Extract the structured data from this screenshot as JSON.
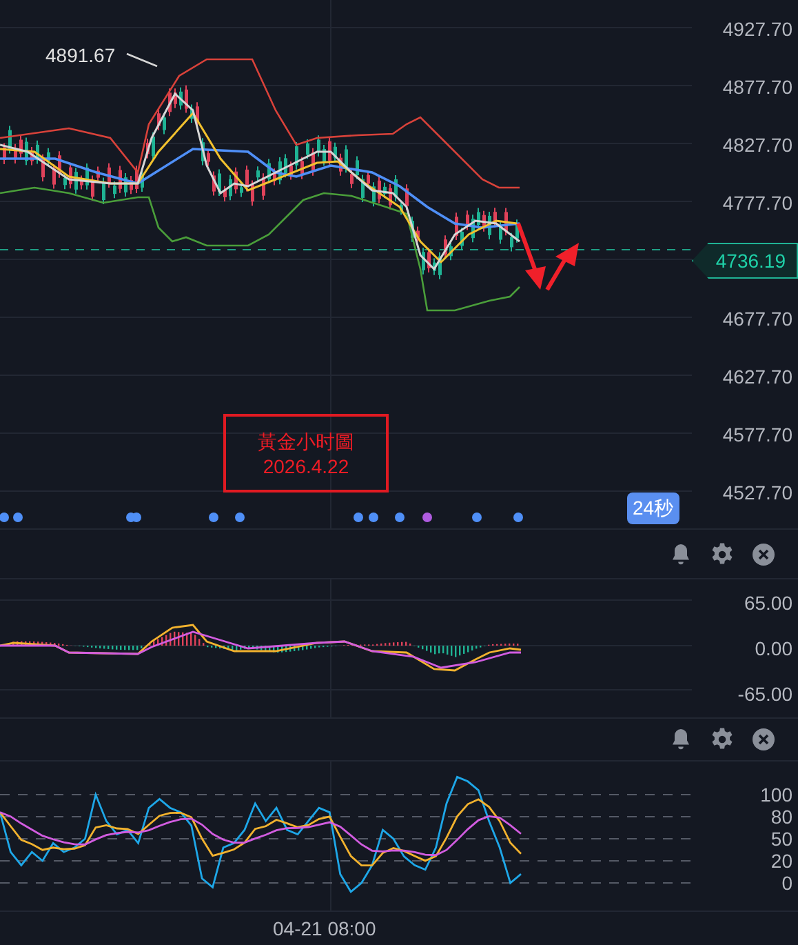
{
  "main_chart": {
    "high_label": "4891.67",
    "price_axis": [
      "4927.70",
      "4877.70",
      "4827.70",
      "4777.70",
      "4677.70",
      "4627.70",
      "4577.70",
      "4527.70"
    ],
    "current_price": "4736.19",
    "annotation": {
      "lines": [
        "黃金小时圖",
        "2026.4.22"
      ]
    },
    "countdown": "24秒",
    "event_markers": [
      {
        "color": "#4f8ff7"
      },
      {
        "color": "#4f8ff7"
      },
      {
        "color": "#4f8ff7"
      },
      {
        "color": "#4f8ff7"
      },
      {
        "color": "#4f8ff7"
      },
      {
        "color": "#4f8ff7"
      },
      {
        "color": "#4f8ff7"
      },
      {
        "color": "#4f8ff7"
      },
      {
        "color": "#4f8ff7"
      },
      {
        "color": "#b05ce0"
      },
      {
        "color": "#4f8ff7"
      },
      {
        "color": "#4f8ff7"
      }
    ]
  },
  "macd_panel": {
    "axis": [
      "65.00",
      "0.00",
      "-65.00"
    ]
  },
  "kdj_panel": {
    "axis": [
      "100",
      "80",
      "50",
      "20",
      "0"
    ]
  },
  "time_axis": [
    "04-21 08:00"
  ]
}
